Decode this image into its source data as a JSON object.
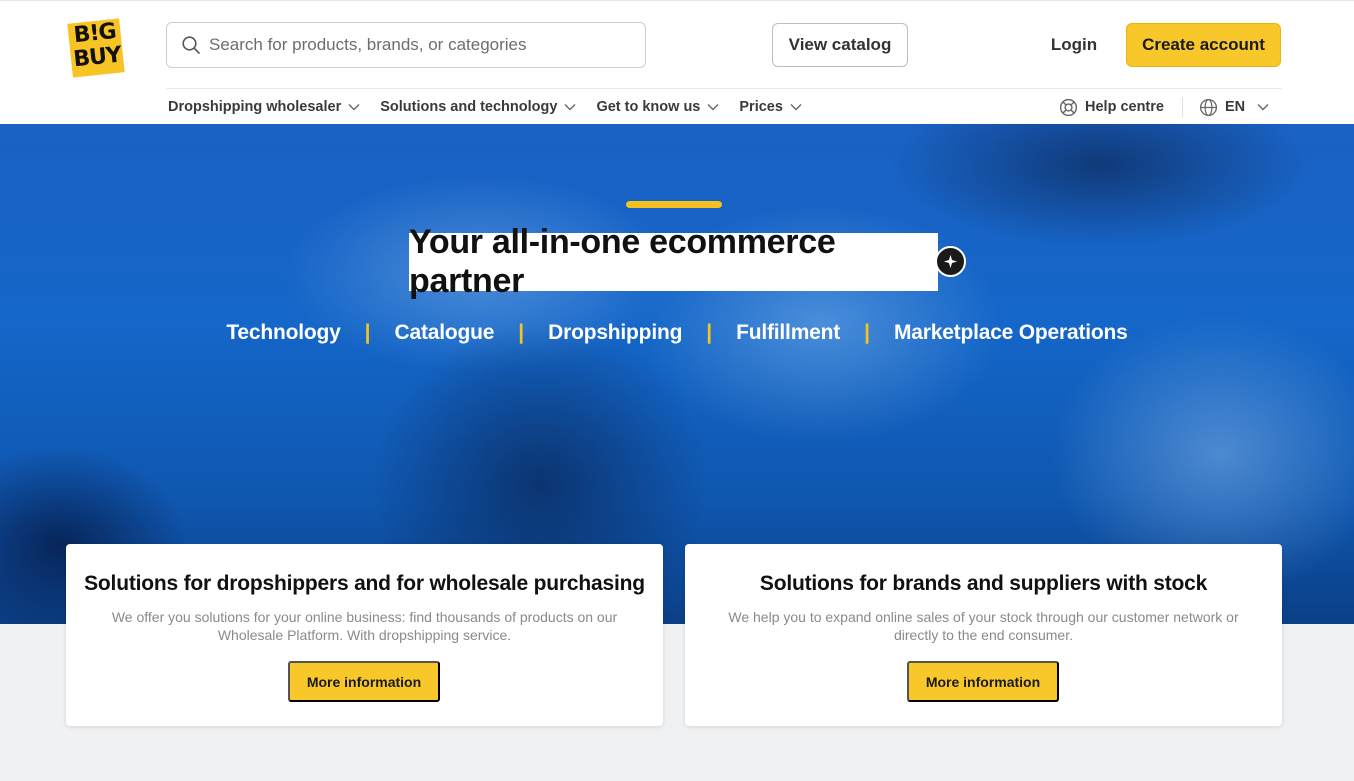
{
  "brand": {
    "logo_text": "B!G BUY",
    "accent_color": "#f8c82b",
    "hero_color": "#1466c8"
  },
  "header": {
    "search_placeholder": "Search for products, brands, or categories",
    "view_catalog": "View catalog",
    "login": "Login",
    "create_account": "Create account"
  },
  "nav": {
    "items": [
      {
        "label": "Dropshipping wholesaler",
        "icon": "chevron-down-icon"
      },
      {
        "label": "Solutions and technology",
        "icon": "chevron-down-icon"
      },
      {
        "label": "Get to know us",
        "icon": "chevron-down-icon"
      },
      {
        "label": "Prices",
        "icon": "chevron-down-icon"
      }
    ],
    "help": "Help centre",
    "language": "EN"
  },
  "hero": {
    "title": "Your all-in-one ecommerce partner",
    "links": [
      "Technology",
      "Catalogue",
      "Dropshipping",
      "Fulfillment",
      "Marketplace Operations"
    ],
    "separator": "|"
  },
  "cards": [
    {
      "title": "Solutions for dropshippers and for wholesale purchasing",
      "text": "We offer you solutions for your online business: find thousands of products on our Wholesale Platform. With dropshipping service.",
      "button": "More information"
    },
    {
      "title": "Solutions for brands and suppliers with stock",
      "text": "We help you to expand online sales of your stock through our customer network or directly to the end consumer.",
      "button": "More information"
    }
  ]
}
